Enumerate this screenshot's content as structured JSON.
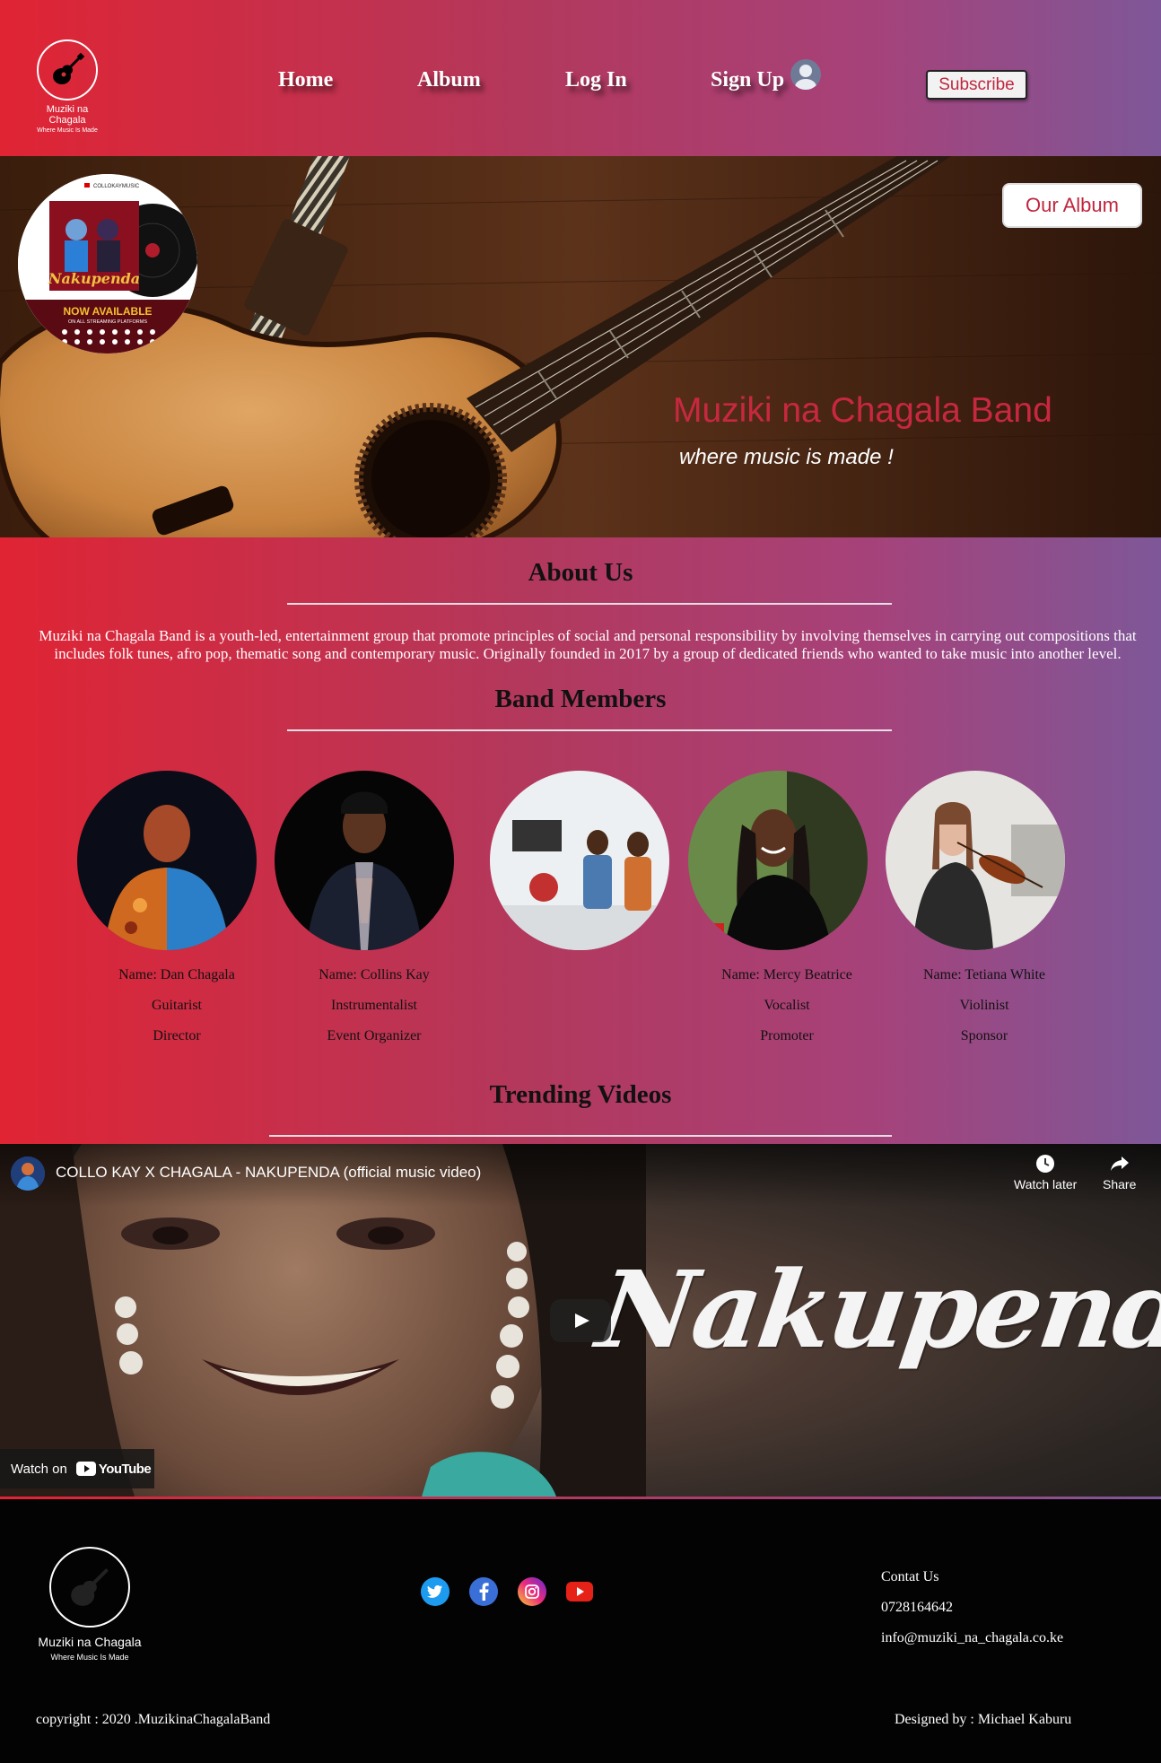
{
  "brand": {
    "name": "Muziki na Chagala",
    "tagline": "Where Music Is Made"
  },
  "nav": {
    "home": "Home",
    "album": "Album",
    "login": "Log In",
    "signup": "Sign Up",
    "subscribe": "Subscribe"
  },
  "hero": {
    "our_album_button": "Our Album",
    "title": "Muziki na Chagala Band",
    "subtitle": "where music is made !",
    "album_cover": {
      "channel": "COLLOKAYMUSIC",
      "album_name": "Nakupenda",
      "now_available": "NOW AVAILABLE",
      "platforms": "ON ALL STREAMING PLATFORMS"
    }
  },
  "about": {
    "title": "About Us",
    "text": "Muziki na Chagala Band is a youth-led, entertainment group that promote principles of social and personal responsibility by involving themselves in carrying out compositions that includes folk tunes, afro pop, thematic song and contemporary music. Originally founded in 2017 by a group of dedicated friends who wanted to take music into another level."
  },
  "members": {
    "title": "Band Members",
    "list": [
      {
        "name": "Name: Dan Chagala",
        "role": "Guitarist",
        "duty": "Director"
      },
      {
        "name": "Name: Collins Kay",
        "role": "Instrumentalist",
        "duty": "Event Organizer"
      },
      {
        "name": "",
        "role": "",
        "duty": ""
      },
      {
        "name": "Name: Mercy Beatrice",
        "role": "Vocalist",
        "duty": "Promoter"
      },
      {
        "name": "Name: Tetiana White",
        "role": "Violinist",
        "duty": "Sponsor"
      }
    ]
  },
  "videos": {
    "title": "Trending Videos",
    "video_title": "COLLO KAY X CHAGALA - NAKUPENDA (official music video)",
    "overlay_text": "Nakupenda",
    "watch_later": "Watch later",
    "share": "Share",
    "watch_on": "Watch on",
    "youtube": "YouTube"
  },
  "footer": {
    "contact_label": "Contat Us",
    "phone": "0728164642",
    "email": "info@muziki_na_chagala.co.ke",
    "copyright": "copyright : 2020 .MuzikinaChagalaBand",
    "designer": "Designed by : Michael Kaburu",
    "socials": [
      "twitter-icon",
      "facebook-icon",
      "instagram-icon",
      "youtube-icon"
    ]
  },
  "colors": {
    "gradient_start": "#e02434",
    "gradient_end": "#7e5798",
    "accent": "#c8283f"
  }
}
